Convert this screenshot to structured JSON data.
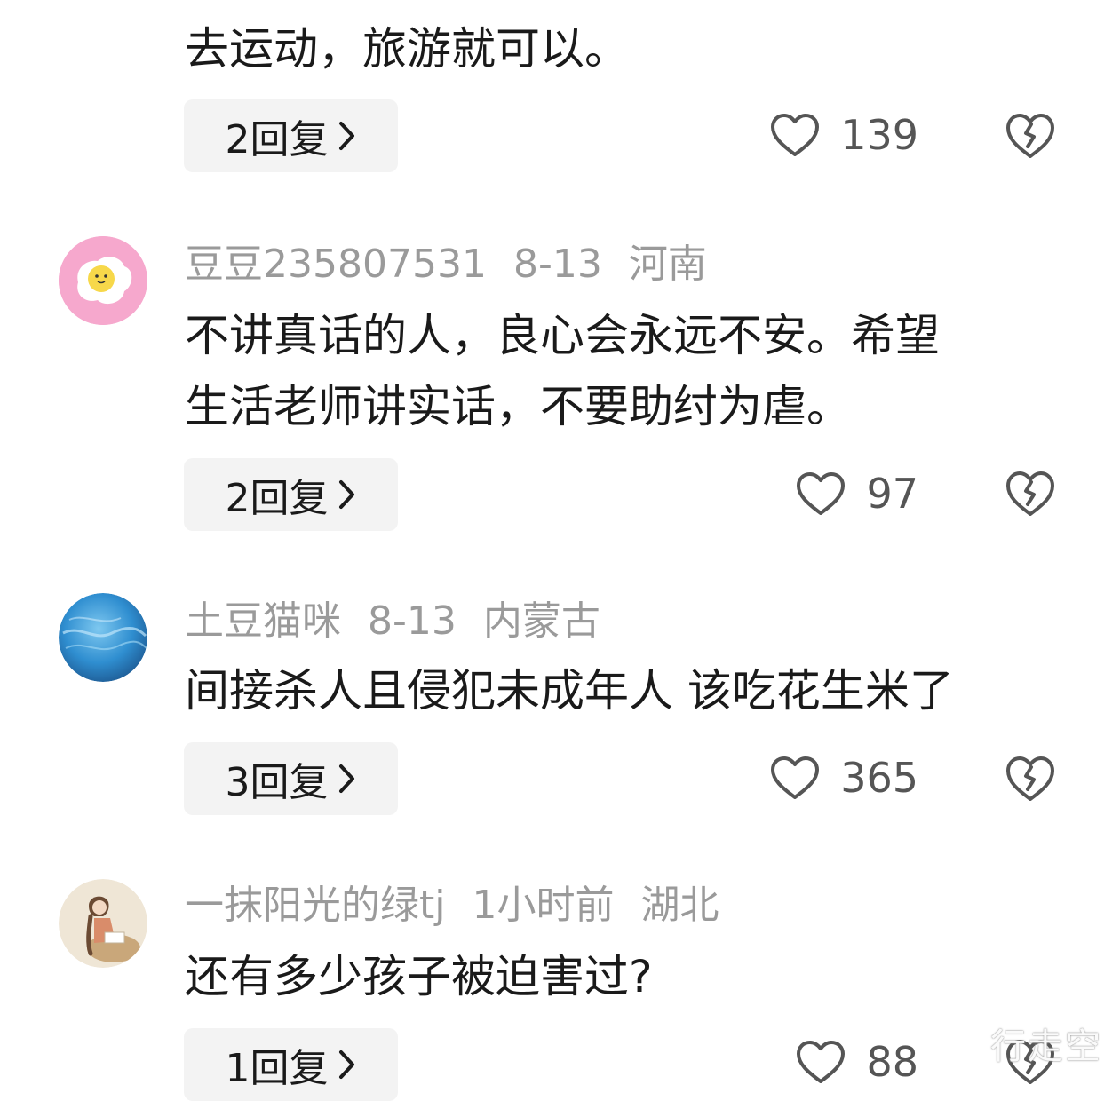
{
  "comments": [
    {
      "lines": [
        "去运动，旅游就可以。"
      ],
      "reply_label": "2回复",
      "like_count": "139"
    },
    {
      "username": "豆豆235807531",
      "date": "8-13",
      "location": "河南",
      "lines": [
        "不讲真话的人，良心会永远不安。希望",
        "生活老师讲实话，不要助纣为虐。"
      ],
      "reply_label": "2回复",
      "like_count": "97"
    },
    {
      "username": "土豆猫咪",
      "date": "8-13",
      "location": "内蒙古",
      "lines": [
        "间接杀人且侵犯未成年人 该吃花生米了"
      ],
      "reply_label": "3回复",
      "like_count": "365"
    },
    {
      "username": "一抹阳光的绿tj",
      "date": "1小时前",
      "location": "湖北",
      "lines": [
        "还有多少孩子被迫害过?"
      ],
      "reply_label": "1回复",
      "like_count": "88"
    }
  ],
  "watermark": "行走空",
  "colors": {
    "text": "#1a1a1a",
    "meta_text": "#9a9a9a",
    "reply_bg": "#f3f3f3",
    "icon_stroke": "#555555"
  },
  "icons": [
    "heart-icon",
    "broken-heart-icon",
    "chevron-right-icon"
  ]
}
